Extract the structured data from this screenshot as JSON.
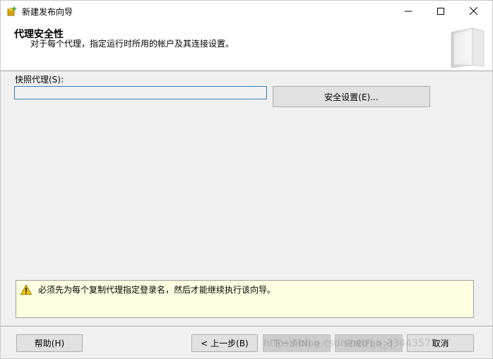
{
  "window": {
    "title": "新建发布向导",
    "icons": {
      "app": "wizard-app-icon",
      "minimize": "minimize-icon",
      "maximize": "maximize-icon",
      "close": "close-icon"
    }
  },
  "header": {
    "title": "代理安全性",
    "subtitle": "对于每个代理，指定运行时所用的帐户及其连接设置。",
    "art_icon": "book-illustration"
  },
  "body": {
    "snapshot_agent_label": "快照代理(S):",
    "snapshot_agent_value": "",
    "security_settings_button": "安全设置(E)..."
  },
  "warning": {
    "icon": "warning-icon",
    "text": "必须先为每个复制代理指定登录名，然后才能继续执行该向导。"
  },
  "footer": {
    "help_button": "帮助(H)",
    "back_button": "< 上一步(B)",
    "next_button": "下一步(N) >",
    "finish_button": "完成(F) >>|",
    "cancel_button": "取消"
  },
  "watermark": "https://blog.csdn.net/qq_33443577",
  "colors": {
    "window_bg": "#f0f0f0",
    "header_bg": "#ffffff",
    "warning_bg": "#ffffe1",
    "input_border": "#3c7fb1"
  }
}
